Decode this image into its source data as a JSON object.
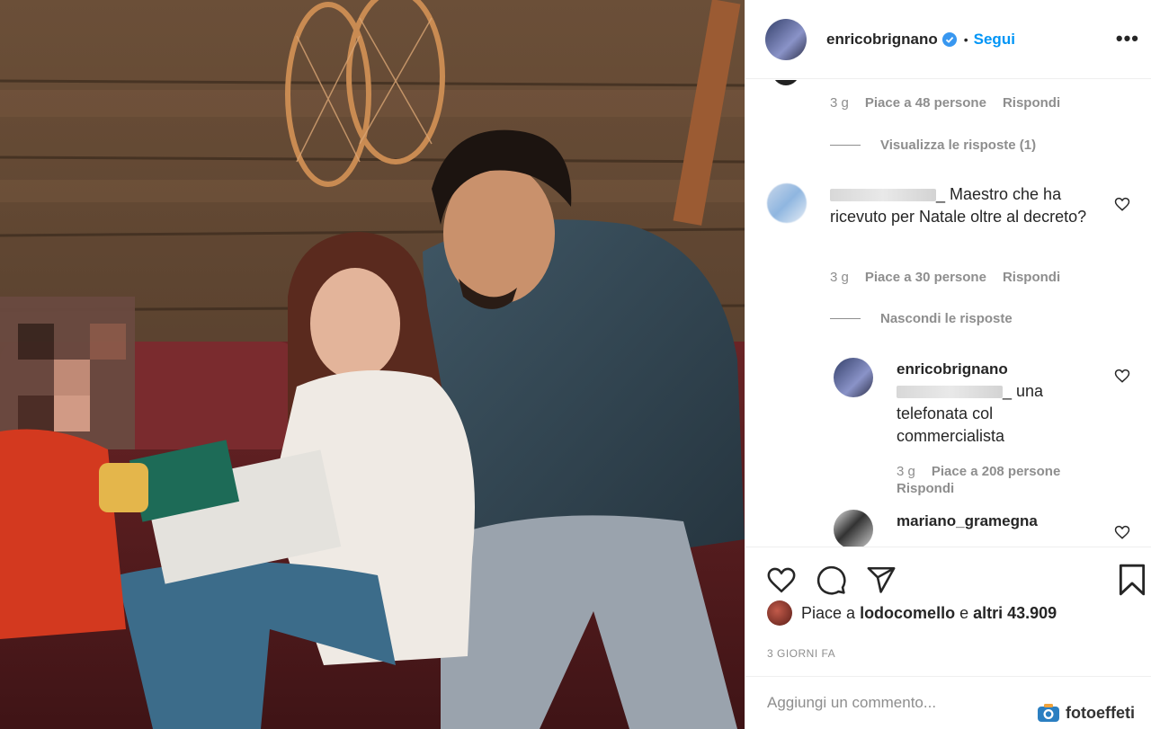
{
  "header": {
    "username": "enricobrignano",
    "separator": "•",
    "follow_label": "Segui",
    "more_label": "•••"
  },
  "comments": {
    "thread1": {
      "time": "3 g",
      "likes": "Piace a 48 persone",
      "reply": "Rispondi",
      "view_replies": "Visualizza le risposte (1)"
    },
    "comment2": {
      "text": "Maestro che ha ricevuto per Natale oltre al decreto?",
      "time": "3 g",
      "likes": "Piace a 30 persone",
      "reply": "Rispondi",
      "hide_replies": "Nascondi le risposte"
    },
    "reply1": {
      "username": "enricobrignano",
      "text": "una telefonata col commercialista",
      "time": "3 g",
      "likes": "Piace a 208 persone",
      "reply": "Rispondi"
    },
    "comment3": {
      "username": "mariano_gramegna"
    }
  },
  "actions": {
    "likes_prefix": "Piace a",
    "likes_user": "lodocomello",
    "likes_middle": "e",
    "likes_others": "altri 43.909",
    "time": "3 GIORNI FA"
  },
  "add_comment": {
    "placeholder": "Aggiungi un commento..."
  },
  "watermark": "fotoeffeti",
  "icons": [
    "heart-icon",
    "comment-icon",
    "share-icon",
    "bookmark-icon",
    "verified-badge-icon",
    "more-options-icon"
  ],
  "colors": {
    "accent": "#0095f6",
    "text": "#262626",
    "secondary": "#8e8e8e"
  }
}
